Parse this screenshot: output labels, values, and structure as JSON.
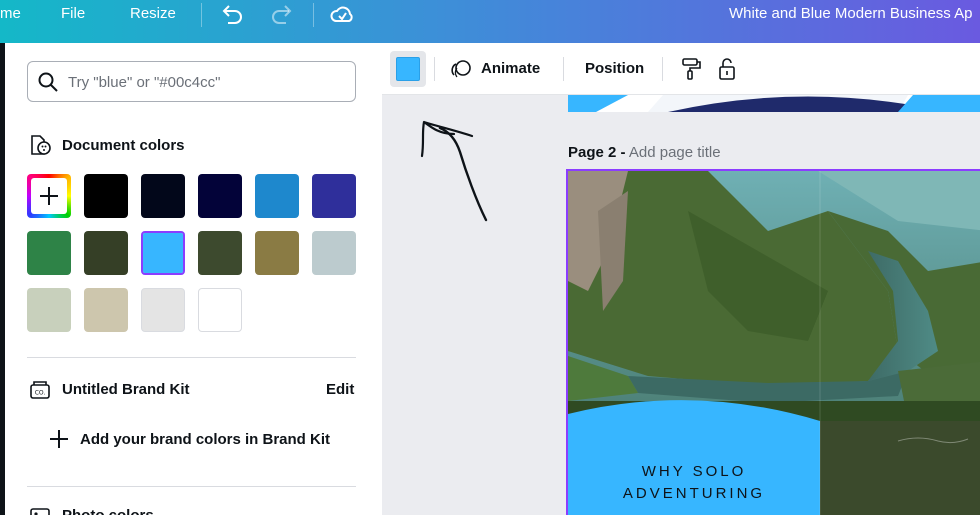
{
  "topbar": {
    "home_fragment": "me",
    "file_label": "File",
    "resize_label": "Resize",
    "design_title": "White and Blue Modern Business Ap"
  },
  "panel": {
    "search_placeholder": "Try \"blue\" or \"#00c4cc\"",
    "document_colors_title": "Document colors",
    "document_colors": [
      {
        "hex": "#000000"
      },
      {
        "hex": "#02071a"
      },
      {
        "hex": "#030339"
      },
      {
        "hex": "#1e88cd"
      },
      {
        "hex": "#2f2f9b"
      },
      {
        "hex": "#2e8347"
      },
      {
        "hex": "#353f26"
      },
      {
        "hex": "#37b6ff",
        "selected": true
      },
      {
        "hex": "#3d4a2e"
      },
      {
        "hex": "#8a7b44"
      },
      {
        "hex": "#bccbce"
      },
      {
        "hex": "#c8d0bc"
      },
      {
        "hex": "#cdc6ad"
      },
      {
        "hex": "#e4e4e4"
      },
      {
        "hex": "#ffffff"
      }
    ],
    "brand_kit_title": "Untitled Brand Kit",
    "brand_kit_edit": "Edit",
    "add_brand_colors": "Add your brand colors in Brand Kit",
    "photo_colors_title": "Photo colors"
  },
  "context_toolbar": {
    "selected_color": "#37b6ff",
    "animate_label": "Animate",
    "position_label": "Position"
  },
  "canvas": {
    "page_number_label": "Page 2 -",
    "page_title_placeholder": "Add page title",
    "page_text_line1": "WHY SOLO",
    "page_text_line2": "ADVENTURING"
  },
  "colors": {
    "accent_purple": "#8b3dff",
    "selected_blue": "#37b6ff"
  }
}
